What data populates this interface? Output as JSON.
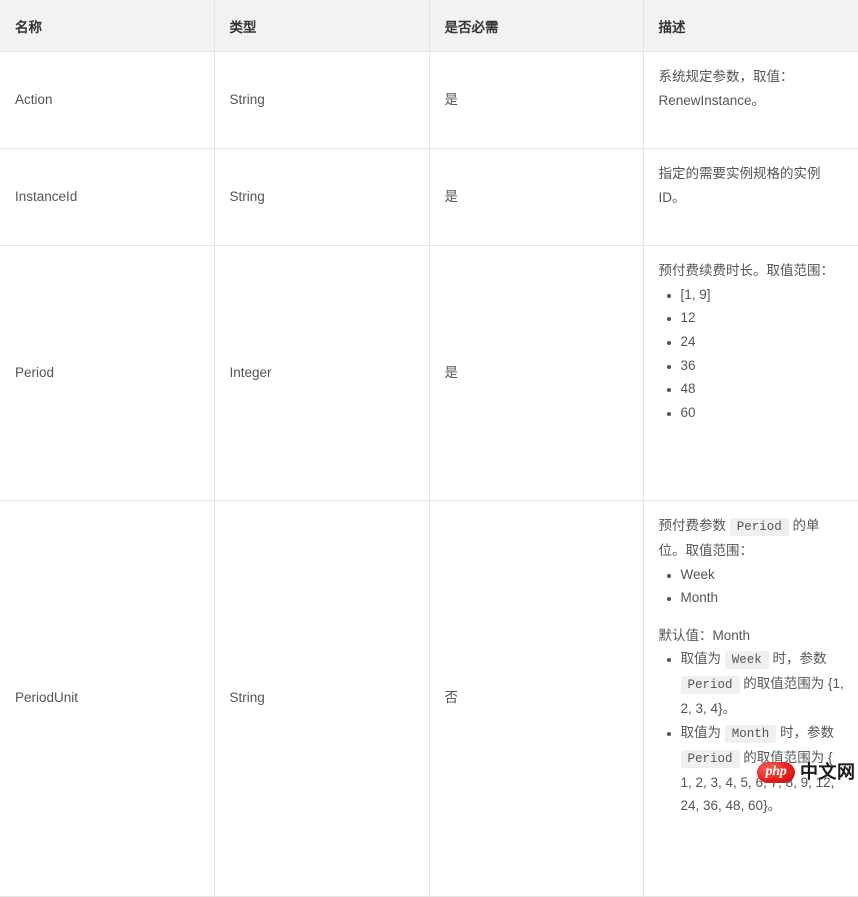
{
  "table": {
    "headers": [
      {
        "label": "名称"
      },
      {
        "label": "类型"
      },
      {
        "label": "是否必需"
      },
      {
        "label": "描述"
      }
    ],
    "rows": [
      {
        "name": "Action",
        "type": "String",
        "required": "是",
        "desc_intro": "系统规定参数，取值：RenewInstance。"
      },
      {
        "name": "InstanceId",
        "type": "String",
        "required": "是",
        "desc_intro": "指定的需要实例规格的实例 ID。"
      },
      {
        "name": "Period",
        "type": "Integer",
        "required": "是",
        "desc_intro": "预付费续费时长。取值范围：",
        "desc_items": [
          "[1, 9]",
          "12",
          "24",
          "36",
          "48",
          "60"
        ]
      },
      {
        "name": "PeriodUnit",
        "type": "String",
        "required": "否",
        "desc_intro_parts": {
          "a": "预付费参数",
          "code1": "Period",
          "b": "的单位。取值范围："
        },
        "desc_items": [
          "Week",
          "Month"
        ],
        "default_line": "默认值：Month",
        "desc_rules": [
          {
            "a": "取值为",
            "code1": "Week",
            "b": "时，参数",
            "code2": "Period",
            "c": "的取值范围为 {1, 2, 3, 4}。"
          },
          {
            "a": "取值为",
            "code1": "Month",
            "b": "时，参数",
            "code2": "Period",
            "c": "的取值范围为 { 1, 2, 3, 4, 5, 6, 7, 8, 9, 12, 24, 36, 48, 60}。"
          }
        ]
      }
    ]
  },
  "watermark": {
    "logo_text": "php",
    "site_text": "中文网"
  }
}
